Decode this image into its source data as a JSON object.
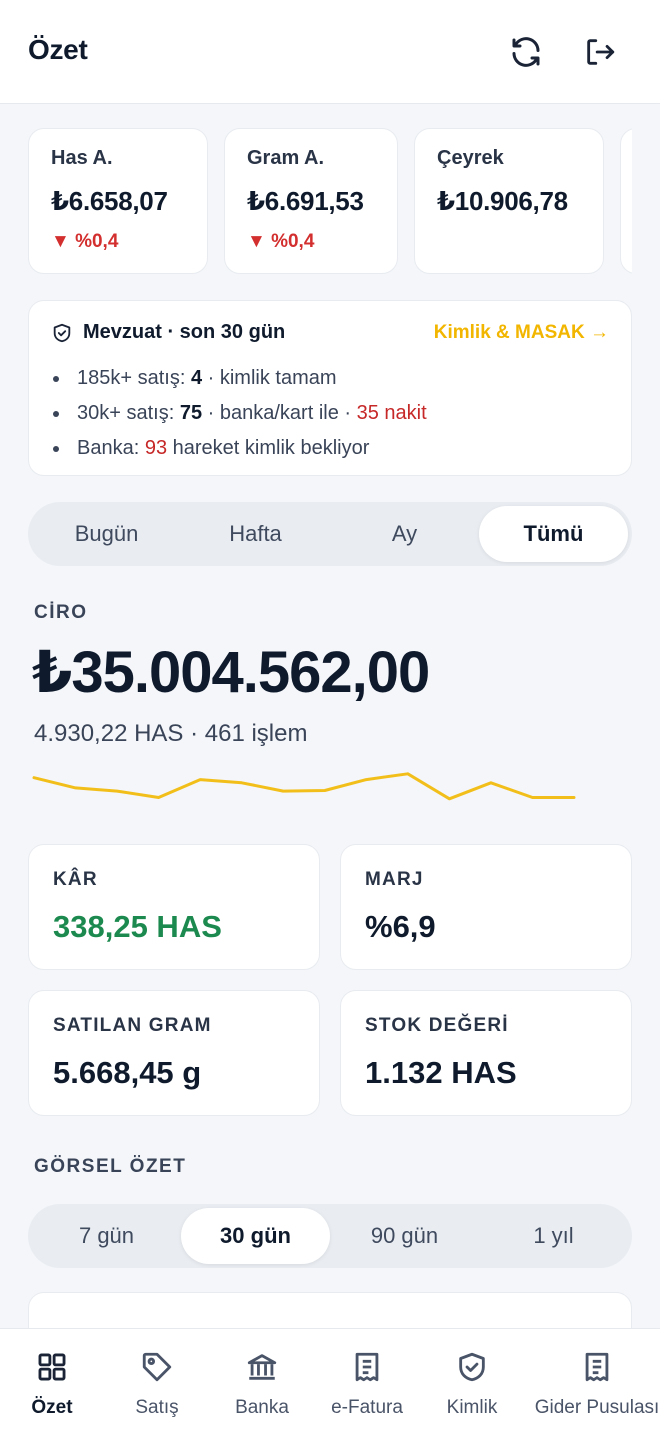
{
  "header": {
    "title": "Özet",
    "refresh_icon": "refresh-icon",
    "logout_icon": "logout-icon"
  },
  "prices": [
    {
      "label": "Has A.",
      "value": "₺6.658,07",
      "change": "▼ %0,4",
      "direction": "down"
    },
    {
      "label": "Gram A.",
      "value": "₺6.691,53",
      "change": "▼ %0,4",
      "direction": "down"
    },
    {
      "label": "Çeyrek",
      "value": "₺10.906,78",
      "change": ""
    }
  ],
  "regulation": {
    "title": "Mevzuat · son 30 gün",
    "link": "Kimlik & MASAK →",
    "line1": {
      "prefix": "185k+ satış: ",
      "count": "4",
      "suffix": " · kimlik tamam"
    },
    "line2": {
      "prefix": "30k+ satış: ",
      "count": "75",
      "middle": " · banka/kart ile · ",
      "cash": "35 nakit"
    },
    "line3": {
      "prefix": "Banka: ",
      "count": "93",
      "suffix": " hareket kimlik bekliyor"
    }
  },
  "period_tabs": [
    "Bugün",
    "Hafta",
    "Ay",
    "Tümü"
  ],
  "period_active": "Tümü",
  "ciro": {
    "label": "CİRO",
    "value": "₺35.004.562,00",
    "sub": "4.930,22 HAS · 461 işlem",
    "trend": [
      0.12,
      0.28,
      0.33,
      0.43,
      0.15,
      0.2,
      0.33,
      0.32,
      0.15,
      0.06,
      0.45,
      0.2,
      0.43,
      0.43
    ],
    "trend_color": "#f2bf1a"
  },
  "stats": {
    "kar": {
      "label": "KÂR",
      "value": "338,25 HAS"
    },
    "marj": {
      "label": "MARJ",
      "value": "%6,9"
    },
    "satilan": {
      "label": "SATILAN GRAM",
      "value": "5.668,45 g"
    },
    "stok": {
      "label": "STOK DEĞERİ",
      "value": "1.132 HAS"
    }
  },
  "gorsel": {
    "title": "GÖRSEL ÖZET",
    "ranges": [
      "7 gün",
      "30 gün",
      "90 gün",
      "1 yıl"
    ],
    "active": "30 gün"
  },
  "nav": [
    {
      "label": "Özet",
      "icon": "grid-icon",
      "active": true
    },
    {
      "label": "Satış",
      "icon": "tag-icon"
    },
    {
      "label": "Banka",
      "icon": "bank-icon"
    },
    {
      "label": "e-Fatura",
      "icon": "receipt-icon"
    },
    {
      "label": "Kimlik",
      "icon": "shield-check-icon"
    },
    {
      "label": "Gider Pusulası",
      "icon": "receipt-icon"
    }
  ],
  "colors": {
    "accent": "#f2b600",
    "negative": "#d32f2f",
    "positive": "#1c8a4f",
    "text": "#0f1b2d"
  }
}
